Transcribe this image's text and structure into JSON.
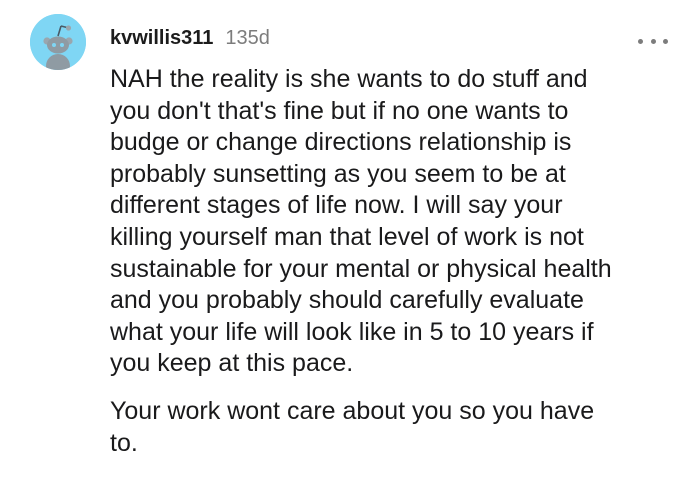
{
  "comment": {
    "username": "kvwillis311",
    "age": "135d",
    "more_icon": "more-horizontal-icon",
    "avatar_icon": "snoo-avatar-icon",
    "avatar_color": "#7fd6f4",
    "paragraphs": [
      [
        "NAH the reality is she wants to do stuff and",
        "you don't that's fine but if no one wants to",
        "budge or change directions relationship is",
        "probably sunsetting as you seem to be at",
        "different stages of life now. I will say your",
        "killing yourself man that level of work is not",
        "sustainable for your mental or physical health",
        "and you probably should carefully evaluate",
        "what your life will look like in 5 to 10 years if",
        "you keep at this pace."
      ],
      [
        "Your work wont care about you so you have",
        "to."
      ]
    ]
  }
}
